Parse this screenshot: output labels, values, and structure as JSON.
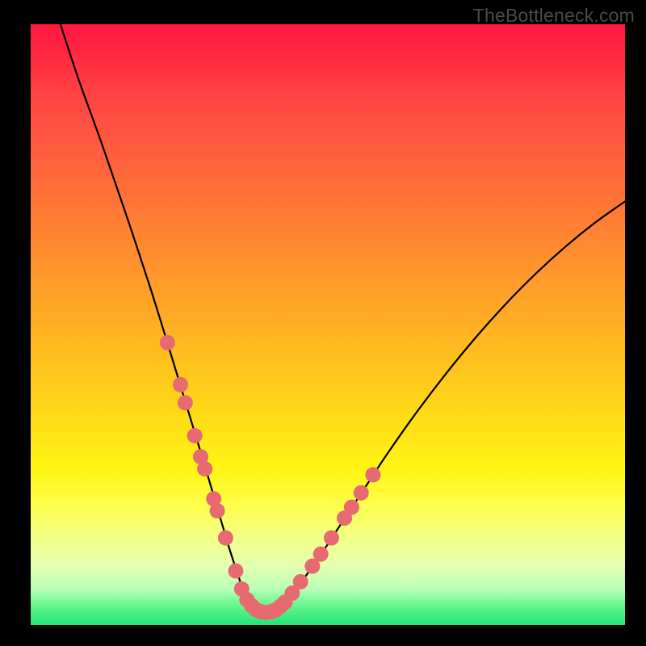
{
  "watermark": "TheBottleneck.com",
  "colors": {
    "frame": "#000000",
    "curve": "#000000",
    "marker_fill": "#e86a71",
    "marker_stroke": "#d95a60"
  },
  "chart_data": {
    "type": "line",
    "title": "",
    "xlabel": "",
    "ylabel": "",
    "xlim": [
      0,
      100
    ],
    "ylim": [
      0,
      100
    ],
    "annotations": [],
    "note": "Bottleneck heat chart: x = component balance position (percent across horizontal axis), y = bottleneck severity (percent, 0 at bottom = optimal/green, 100 at top = severe/red). Curve is the bottleneck curve; markers are highlighted sample points along the curve.",
    "series": [
      {
        "name": "bottleneck-curve",
        "x": [
          5,
          8,
          12,
          16,
          20,
          23,
          25,
          27,
          29,
          30.5,
          32,
          33.5,
          35,
          36,
          37,
          38,
          39.5,
          41,
          43,
          45,
          48,
          52,
          56,
          60,
          65,
          70,
          75,
          80,
          85,
          90,
          95,
          100
        ],
        "y": [
          100,
          91,
          80,
          68.5,
          56.5,
          47,
          40.5,
          34,
          27.5,
          22.5,
          17.5,
          12.5,
          8,
          5,
          3,
          2,
          2,
          2.5,
          4,
          6.5,
          10.5,
          16.5,
          22.5,
          28.5,
          35.5,
          42,
          48,
          53.5,
          58.5,
          63,
          67,
          70.5
        ]
      }
    ],
    "markers": {
      "name": "highlighted-points",
      "points": [
        {
          "x": 23.0,
          "y": 47.0
        },
        {
          "x": 25.2,
          "y": 40.0
        },
        {
          "x": 26.0,
          "y": 37.0
        },
        {
          "x": 27.6,
          "y": 31.5
        },
        {
          "x": 28.6,
          "y": 28.0
        },
        {
          "x": 29.3,
          "y": 26.0
        },
        {
          "x": 30.8,
          "y": 21.0
        },
        {
          "x": 31.4,
          "y": 19.0
        },
        {
          "x": 32.8,
          "y": 14.5
        },
        {
          "x": 34.5,
          "y": 9.0
        },
        {
          "x": 35.5,
          "y": 6.0
        },
        {
          "x": 36.4,
          "y": 4.2
        },
        {
          "x": 37.2,
          "y": 3.2
        },
        {
          "x": 38.0,
          "y": 2.5
        },
        {
          "x": 38.8,
          "y": 2.2
        },
        {
          "x": 39.6,
          "y": 2.1
        },
        {
          "x": 40.4,
          "y": 2.2
        },
        {
          "x": 41.2,
          "y": 2.5
        },
        {
          "x": 42.0,
          "y": 3.1
        },
        {
          "x": 42.8,
          "y": 3.8
        },
        {
          "x": 44.0,
          "y": 5.3
        },
        {
          "x": 45.4,
          "y": 7.2
        },
        {
          "x": 47.4,
          "y": 9.8
        },
        {
          "x": 48.8,
          "y": 11.8
        },
        {
          "x": 50.6,
          "y": 14.5
        },
        {
          "x": 52.8,
          "y": 17.8
        },
        {
          "x": 54.0,
          "y": 19.6
        },
        {
          "x": 55.6,
          "y": 22.0
        },
        {
          "x": 57.6,
          "y": 25.0
        }
      ]
    }
  }
}
